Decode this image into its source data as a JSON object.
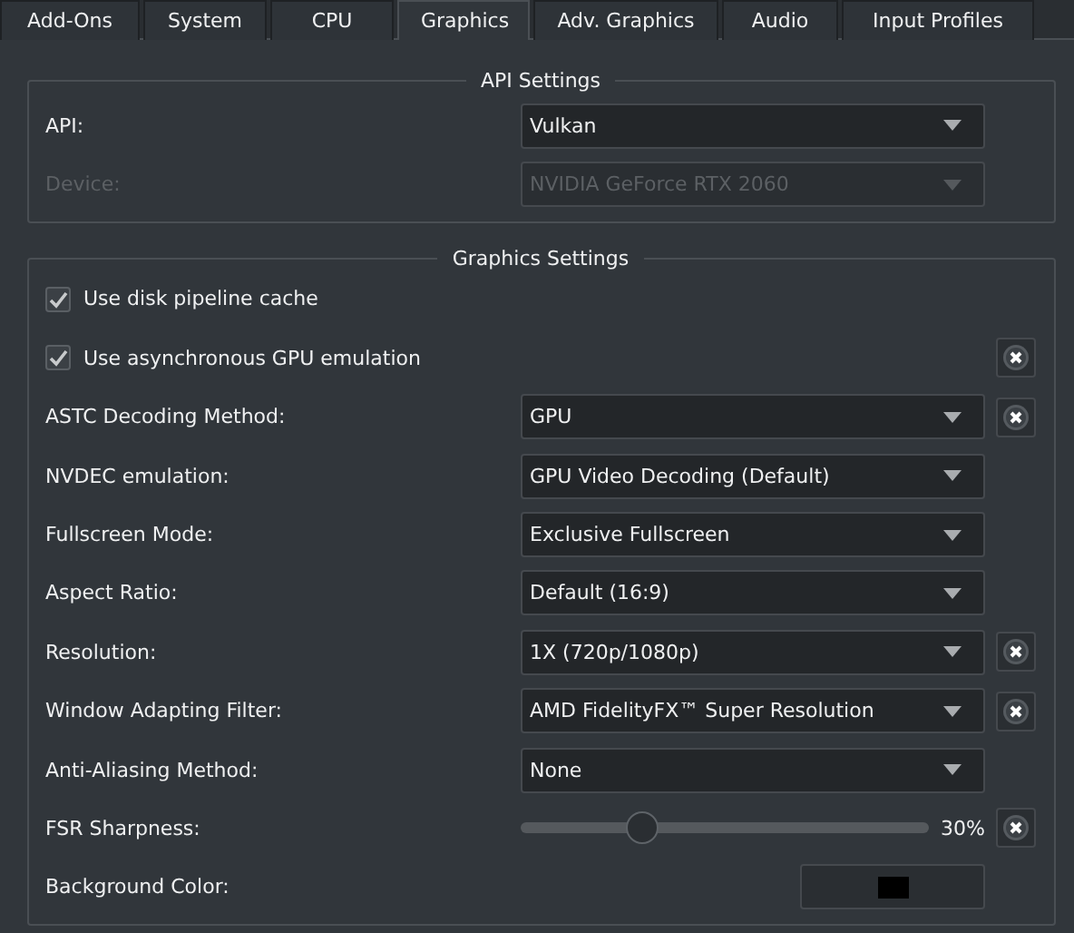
{
  "tabs": [
    {
      "label": "Add-Ons",
      "selected": false
    },
    {
      "label": "System",
      "selected": false
    },
    {
      "label": "CPU",
      "selected": false
    },
    {
      "label": "Graphics",
      "selected": true
    },
    {
      "label": "Adv. Graphics",
      "selected": false
    },
    {
      "label": "Audio",
      "selected": false
    },
    {
      "label": "Input Profiles",
      "selected": false
    }
  ],
  "groups": [
    {
      "title": "API Settings",
      "rows": [
        {
          "kind": "combo",
          "label": "API:",
          "value": "Vulkan",
          "disabled": false
        },
        {
          "kind": "combo",
          "label": "Device:",
          "value": "NVIDIA GeForce RTX 2060",
          "disabled": true
        }
      ]
    },
    {
      "title": "Graphics Settings",
      "rows": [
        {
          "kind": "checkbox",
          "label": "Use disk pipeline cache",
          "checked": true,
          "reset": false
        },
        {
          "kind": "checkbox",
          "label": "Use asynchronous GPU emulation",
          "checked": true,
          "reset": true
        },
        {
          "kind": "combo",
          "label": "ASTC Decoding Method:",
          "value": "GPU",
          "disabled": false,
          "reset": true
        },
        {
          "kind": "combo",
          "label": "NVDEC emulation:",
          "value": "GPU Video Decoding (Default)",
          "disabled": false,
          "reset": false
        },
        {
          "kind": "combo",
          "label": "Fullscreen Mode:",
          "value": "Exclusive Fullscreen",
          "disabled": false,
          "reset": false
        },
        {
          "kind": "combo",
          "label": "Aspect Ratio:",
          "value": "Default (16:9)",
          "disabled": false,
          "reset": false
        },
        {
          "kind": "combo",
          "label": "Resolution:",
          "value": "1X (720p/1080p)",
          "disabled": false,
          "reset": true
        },
        {
          "kind": "combo",
          "label": "Window Adapting Filter:",
          "value": "AMD FidelityFX™ Super Resolution",
          "disabled": false,
          "reset": true
        },
        {
          "kind": "combo",
          "label": "Anti-Aliasing Method:",
          "value": "None",
          "disabled": false,
          "reset": false
        },
        {
          "kind": "slider",
          "label": "FSR Sharpness:",
          "level": 0.3,
          "reading": "30%",
          "reset": true
        },
        {
          "kind": "color",
          "label": "Background Color:",
          "color": "#000000",
          "reset": false
        }
      ]
    }
  ]
}
